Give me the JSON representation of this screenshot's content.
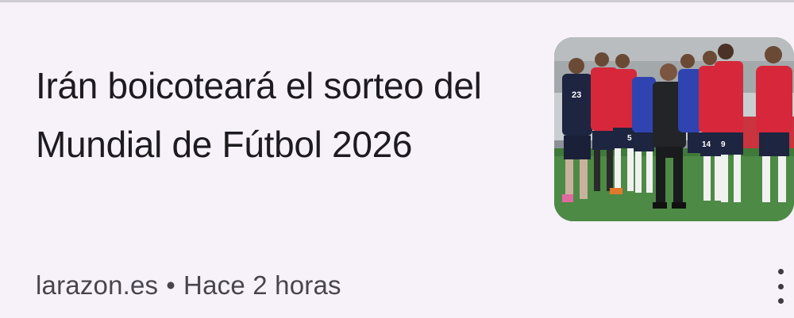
{
  "article": {
    "headline": "Irán boicoteará el sorteo del Mundial de Fútbol 2026",
    "source": "larazon.es",
    "separator": "•",
    "time": "Hace 2 horas",
    "thumbnail_icon": "team-training-photo",
    "more_icon": "more-vert-icon"
  },
  "colors": {
    "background": "#f7f2f9",
    "headline_text": "#1d1b20",
    "meta_text": "#49454f",
    "jersey_red": "#d6283a",
    "jersey_navy": "#1e2540",
    "pitch_green": "#3f7a3a"
  }
}
